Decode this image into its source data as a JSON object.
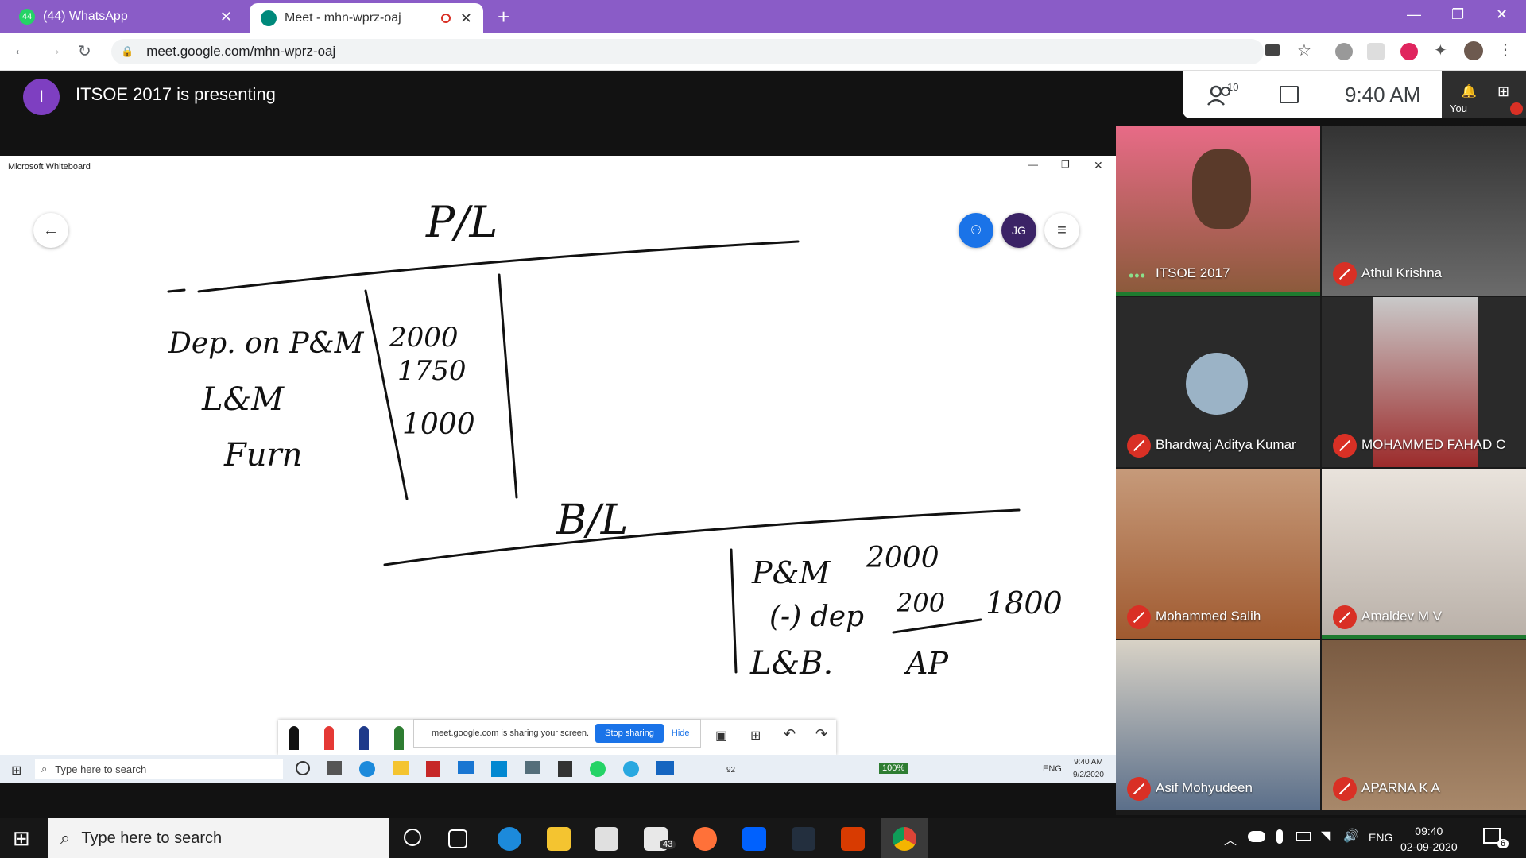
{
  "browser": {
    "tabs": [
      {
        "title": "(44) WhatsApp",
        "badge": "44"
      },
      {
        "title": "Meet - mhn-wprz-oaj"
      }
    ],
    "url": "meet.google.com/mhn-wprz-oaj",
    "colors": {
      "tabstrip": "#8a5cc7",
      "whatsapp": "#25d366",
      "meet": "#00897b"
    }
  },
  "meet": {
    "presenter_initial": "I",
    "presenting_text": "ITSOE 2017 is presenting",
    "participant_count": "10",
    "time": "9:40 AM",
    "self_label": "You",
    "participants": [
      {
        "name": "ITSOE 2017",
        "muted": false
      },
      {
        "name": "Athul Krishna",
        "muted": true
      },
      {
        "name": "Bhardwaj Aditya Kumar",
        "muted": true
      },
      {
        "name": "MOHAMMED FAHAD C",
        "muted": true
      },
      {
        "name": "Mohammed Salih",
        "muted": true
      },
      {
        "name": "Amaldev M V",
        "muted": true
      },
      {
        "name": "Asif Mohyudeen",
        "muted": true
      },
      {
        "name": "APARNA K A",
        "muted": true
      }
    ]
  },
  "whiteboard": {
    "window_title": "Microsoft Whiteboard",
    "user_initials": "JG",
    "handwriting": {
      "t1": "P/L",
      "r1": "Dep. on P&M",
      "r2": "L&M",
      "r3": "Furn",
      "v1": "2000",
      "v2": "1750",
      "v3": "1000",
      "t2": "B/L",
      "b1": "P&M",
      "b2": "(-) dep",
      "b3": "L&B.",
      "b4": "2000",
      "b5": "200",
      "b6": "1800",
      "b7": "AP"
    }
  },
  "share_bar": {
    "message": "meet.google.com is sharing your screen.",
    "stop": "Stop sharing",
    "hide": "Hide"
  },
  "inner_taskbar": {
    "search": "Type here to search",
    "battery": "100%",
    "lang": "ENG",
    "time": "9:40 AM",
    "date": "9/2/2020",
    "badge": "92"
  },
  "taskbar": {
    "search": "Type here to search",
    "mail_badge": "43",
    "lang": "ENG",
    "time": "09:40",
    "date": "02-09-2020",
    "notif": "6"
  }
}
